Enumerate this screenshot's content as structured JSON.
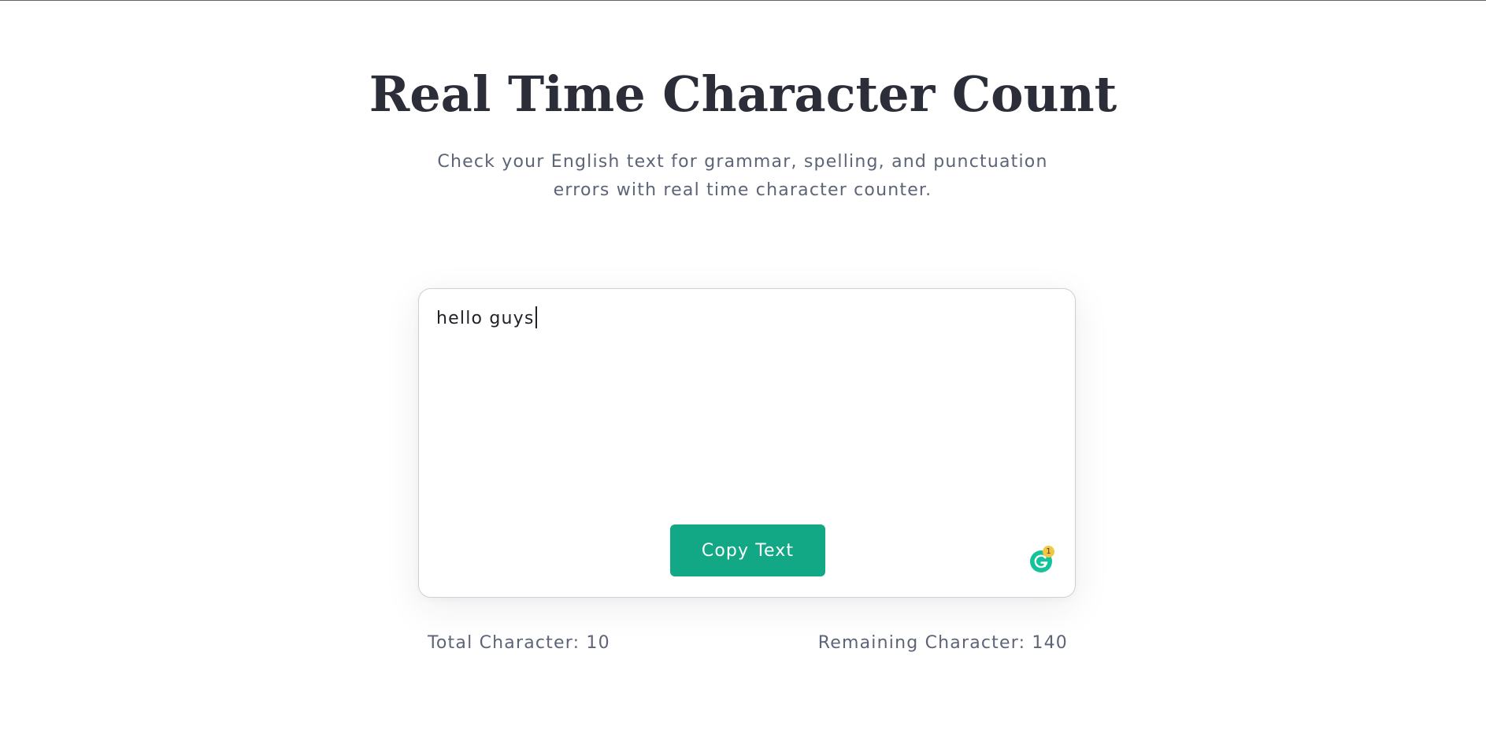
{
  "header": {
    "title": "Real Time Character Count",
    "subtitle": "Check your English text for grammar, spelling, and punctuation errors with real time character counter."
  },
  "editor": {
    "text": "hello guys",
    "copy_button_label": "Copy Text",
    "grammarly_badge_count": "1"
  },
  "stats": {
    "total_label": "Total Character: 10",
    "remaining_label": "Remaining Character: 140"
  },
  "colors": {
    "accent": "#12a785",
    "title": "#2b2d38",
    "muted_text": "#5e6478",
    "badge": "#f3c742"
  },
  "icons": {
    "grammarly": "grammarly-icon"
  }
}
